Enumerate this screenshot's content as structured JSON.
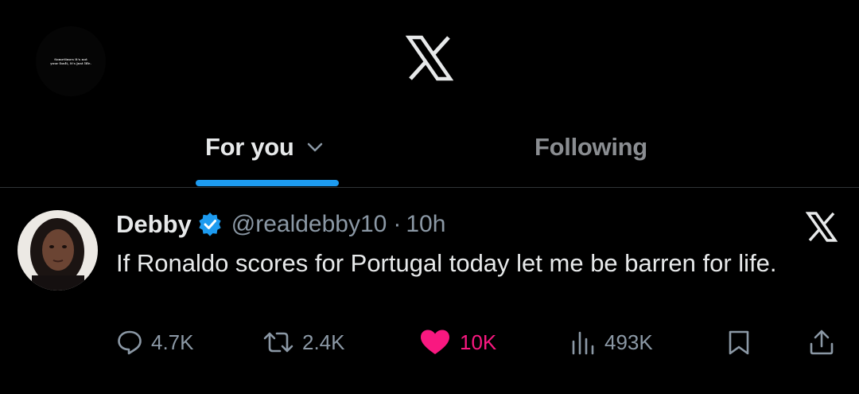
{
  "header": {
    "avatar_caption_line1": "Sometimes it's not",
    "avatar_caption_line2": "your fault, it's just life.",
    "logo_icon": "x-logo-icon"
  },
  "tabs": [
    {
      "label": "For you",
      "active": true,
      "icon": "chevron-down-icon"
    },
    {
      "label": "Following",
      "active": false
    }
  ],
  "colors": {
    "background": "#000000",
    "accent": "#1d9bf0",
    "like": "#f91880",
    "muted_text": "#8b98a5",
    "primary_text": "#e7e9ea"
  },
  "tweet": {
    "display_name": "Debby",
    "verified": true,
    "handle": "@realdebby10",
    "separator": "·",
    "time": "10h",
    "text": "If Ronaldo scores for Portugal today let me be barren for life.",
    "actions": {
      "replies": "4.7K",
      "retweets": "2.4K",
      "likes": "10K",
      "views": "493K"
    }
  }
}
